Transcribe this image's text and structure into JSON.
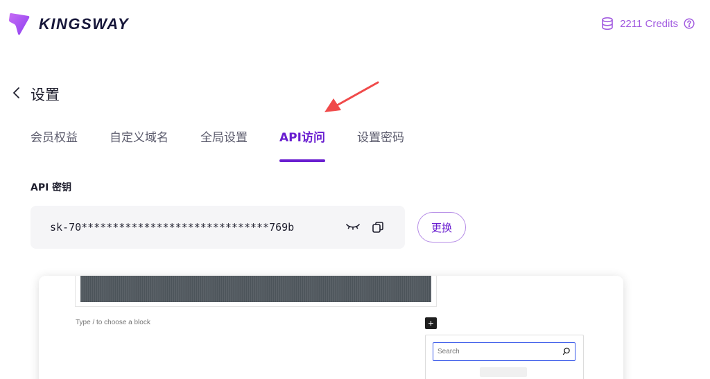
{
  "header": {
    "brand": "KINGSWAY",
    "credits": "2211 Credits",
    "colors": {
      "accent": "#6a1fd0",
      "credits": "#a25be0",
      "logo": "#b15bf0"
    }
  },
  "page": {
    "title": "设置"
  },
  "tabs": [
    {
      "label": "会员权益",
      "active": false
    },
    {
      "label": "自定义域名",
      "active": false
    },
    {
      "label": "全局设置",
      "active": false
    },
    {
      "label": "API访问",
      "active": true
    },
    {
      "label": "设置密码",
      "active": false
    }
  ],
  "api": {
    "section_label": "API 密钥",
    "key_masked": "sk-70******************************769b",
    "change_label": "更换"
  },
  "preview": {
    "block_hint": "Type / to choose a block",
    "plus_label": "+",
    "search_placeholder": "Search"
  }
}
